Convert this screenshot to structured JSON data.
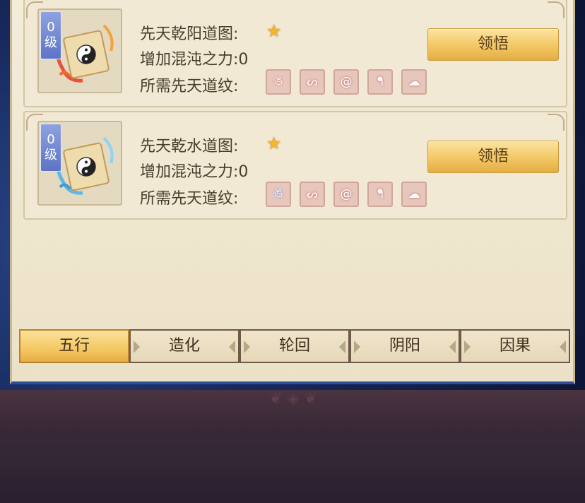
{
  "cards": [
    {
      "level_number": "0",
      "level_unit": "级",
      "title": "先天乾阳道图:",
      "stars": 1,
      "chaos_power_label": "增加混沌之力:",
      "chaos_power_value": "0",
      "required_label": "所需先天道纹:",
      "rune_count": 5,
      "rune_theme": "red",
      "button_label": "领悟"
    },
    {
      "level_number": "0",
      "level_unit": "级",
      "title": "先天乾水道图:",
      "stars": 1,
      "chaos_power_label": "增加混沌之力:",
      "chaos_power_value": "0",
      "required_label": "所需先天道纹:",
      "rune_count": 5,
      "rune_theme": "blue",
      "button_label": "领悟"
    }
  ],
  "tabs": [
    {
      "label": "五行",
      "active": true
    },
    {
      "label": "造化",
      "active": false
    },
    {
      "label": "轮回",
      "active": false
    },
    {
      "label": "阴阳",
      "active": false
    },
    {
      "label": "因果",
      "active": false
    }
  ],
  "colors": {
    "accent_gold": "#f2c764",
    "panel_bg": "#efe6cf",
    "badge_blue": "#5d74c6",
    "frame_blue": "#17285c"
  }
}
